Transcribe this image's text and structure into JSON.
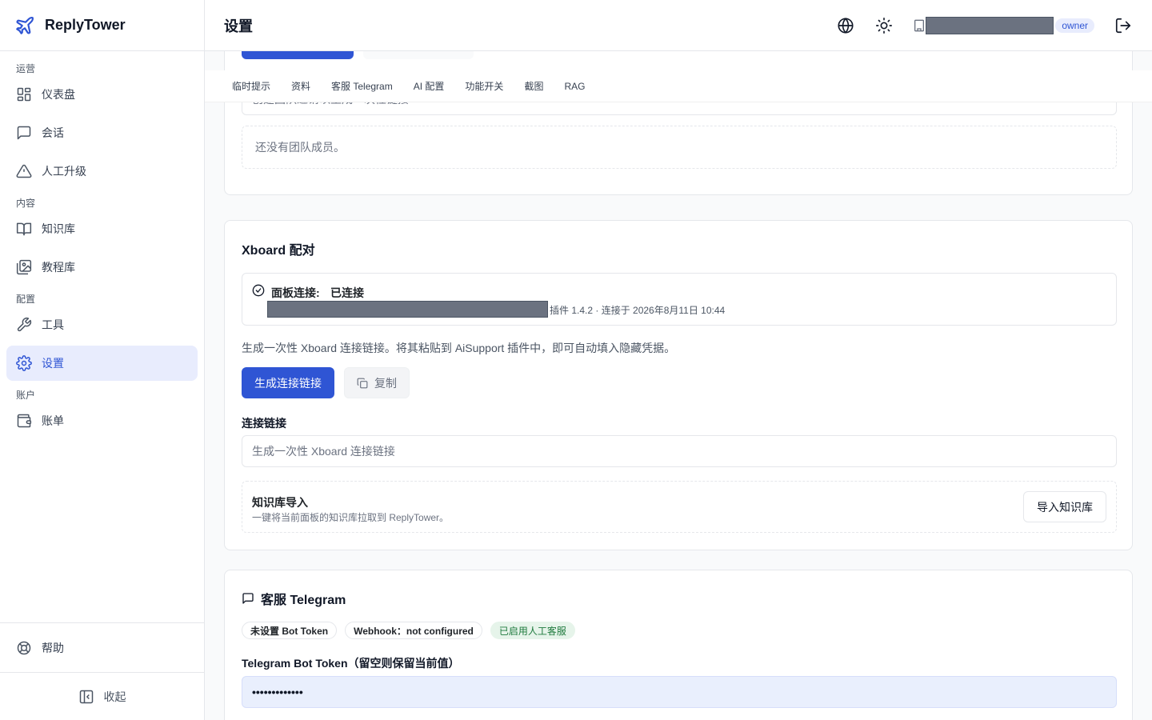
{
  "app": {
    "name": "ReplyTower"
  },
  "sidebar": {
    "sections": [
      {
        "label": "运营",
        "items": [
          {
            "label": "仪表盘",
            "icon": "dashboard-icon"
          },
          {
            "label": "会话",
            "icon": "chat-icon"
          },
          {
            "label": "人工升级",
            "icon": "warning-icon"
          }
        ]
      },
      {
        "label": "内容",
        "items": [
          {
            "label": "知识库",
            "icon": "book-icon"
          },
          {
            "label": "教程库",
            "icon": "gallery-icon"
          }
        ]
      },
      {
        "label": "配置",
        "items": [
          {
            "label": "工具",
            "icon": "wrench-icon"
          },
          {
            "label": "设置",
            "icon": "gear-icon",
            "active": true
          }
        ]
      },
      {
        "label": "账户",
        "items": [
          {
            "label": "账单",
            "icon": "wallet-icon"
          }
        ]
      }
    ],
    "help_label": "帮助",
    "collapse_label": "收起"
  },
  "header": {
    "title": "设置",
    "role": "owner"
  },
  "tabs": [
    "临时提示",
    "资料",
    "客服 Telegram",
    "AI 配置",
    "功能开关",
    "截图",
    "RAG"
  ],
  "team": {
    "invite_placeholder": "创建团队邀请以生成一次性链接",
    "empty_text": "还没有团队成员。"
  },
  "xboard": {
    "title": "Xboard 配对",
    "status_label": "面板连接:",
    "status_value": "已连接",
    "connection_meta": "插件 1.4.2 · 连接于 2026年8月11日 10:44",
    "description": "生成一次性 Xboard 连接链接。将其粘贴到 AiSupport 插件中，即可自动填入隐藏凭据。",
    "generate_button": "生成连接链接",
    "copy_button": "复制",
    "link_label": "连接链接",
    "link_placeholder": "生成一次性 Xboard 连接链接",
    "kb_import_title": "知识库导入",
    "kb_import_desc": "一键将当前面板的知识库拉取到 ReplyTower。",
    "kb_import_button": "导入知识库"
  },
  "telegram": {
    "title": "客服 Telegram",
    "badges": [
      "未设置 Bot Token",
      "Webhook：not configured",
      "已启用人工客服"
    ],
    "token_label": "Telegram Bot Token（留空则保留当前值）",
    "token_value": "•••••••••••••"
  },
  "colors": {
    "accent": "#2f55d4",
    "active_bg": "#e8ecfd",
    "success_bg": "#e6f4ea",
    "success_fg": "#1f7a3d"
  }
}
